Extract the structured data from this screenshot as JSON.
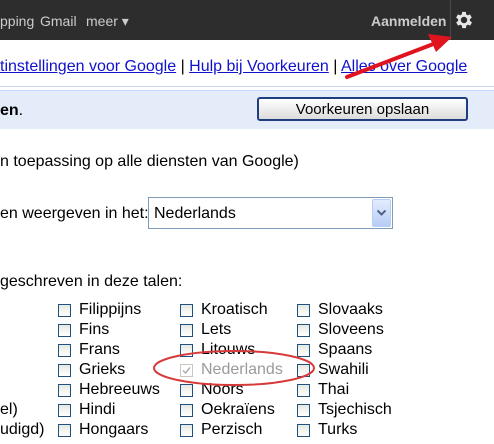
{
  "topbar": {
    "items": [
      "pping",
      "Gmail",
      "meer ▾"
    ],
    "signin": "Aanmelden",
    "gear_icon": "gear-icon"
  },
  "links": {
    "item1": "tinstellingen voor Google",
    "item2": "Hulp bij Voorkeuren",
    "item3": "Alles over Google",
    "sep": "|"
  },
  "savebar": {
    "title": "en",
    "title_suffix": ".",
    "save_button": "Voorkeuren opslaan"
  },
  "interface": {
    "note": "n toepassing op alle diensten van Google)",
    "label": "en weergeven in het:",
    "selected": "Nederlands"
  },
  "search_languages": {
    "heading": "geschreven in deze talen:",
    "partial_labels": [
      "el)",
      "udigd)"
    ],
    "columns": [
      [
        {
          "label": "Filippijns",
          "checked": false
        },
        {
          "label": "Fins",
          "checked": false
        },
        {
          "label": "Frans",
          "checked": false
        },
        {
          "label": "Grieks",
          "checked": false
        },
        {
          "label": "Hebreeuws",
          "checked": false
        },
        {
          "label": "Hindi",
          "checked": false
        },
        {
          "label": "Hongaars",
          "checked": false
        }
      ],
      [
        {
          "label": "Kroatisch",
          "checked": false
        },
        {
          "label": "Lets",
          "checked": false
        },
        {
          "label": "Litouws",
          "checked": false
        },
        {
          "label": "Nederlands",
          "checked": true,
          "disabled": true
        },
        {
          "label": "Noors",
          "checked": false
        },
        {
          "label": "Oekraïens",
          "checked": false
        },
        {
          "label": "Perzisch",
          "checked": false
        }
      ],
      [
        {
          "label": "Slovaaks",
          "checked": false
        },
        {
          "label": "Sloveens",
          "checked": false
        },
        {
          "label": "Spaans",
          "checked": false
        },
        {
          "label": "Swahili",
          "checked": false
        },
        {
          "label": "Thai",
          "checked": false
        },
        {
          "label": "Tsjechisch",
          "checked": false
        },
        {
          "label": "Turks",
          "checked": false
        }
      ]
    ]
  },
  "annotations": {
    "arrow_color": "#e0141e",
    "ellipse_color": "#d63a3a"
  }
}
